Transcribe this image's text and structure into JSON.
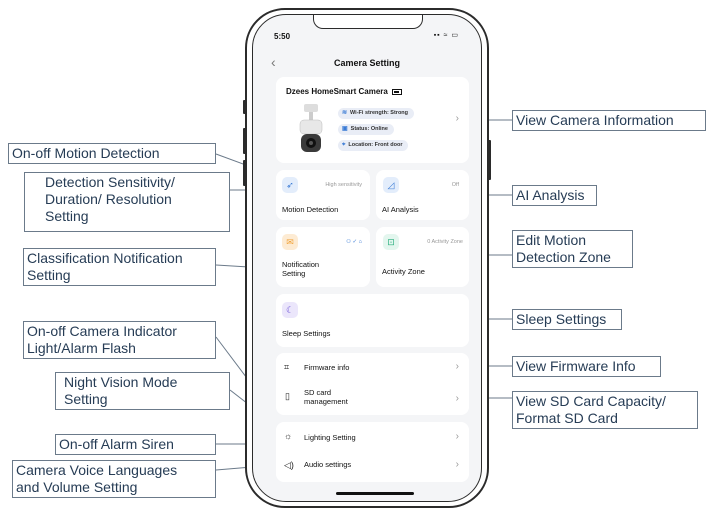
{
  "status_bar": {
    "time": "5:50",
    "icons": "▪▪ ≈ ▭"
  },
  "header": {
    "back": "‹",
    "title": "Camera Setting"
  },
  "camera_card": {
    "name": "Dzees HomeSmart Camera",
    "wifi": "Wi-Fi strength: Strong",
    "status": "Status: Online",
    "location": "Location: Front door"
  },
  "tiles": {
    "motion": {
      "label": "Motion Detection",
      "value": "High sensitivity"
    },
    "ai": {
      "label": "AI Analysis",
      "value": "Off"
    },
    "notification": {
      "label": "Notification Setting"
    },
    "activity": {
      "label": "Activity Zone",
      "value": "0 Activity Zone"
    },
    "sleep": {
      "label": "Sleep Settings"
    }
  },
  "list_rows": {
    "firmware": "Firmware info",
    "sd_card": "SD card management",
    "lighting": "Lighting Setting",
    "audio": "Audio settings"
  },
  "callouts": {
    "motion_onoff": "On-off Motion Detection",
    "detection_setting": "Detection Sensitivity/\nDuration/ Resolution\nSetting",
    "classification": "Classification Notification\nSetting",
    "indicator": "On-off Camera Indicator\nLight/Alarm Flash",
    "night_vision": "Night Vision Mode\nSetting",
    "siren": "On-off Alarm Siren",
    "voice": "Camera Voice Languages\nand Volume Setting",
    "view_camera_info": "View Camera Information",
    "ai_analysis": "AI Analysis",
    "edit_motion_zone": "Edit Motion\nDetection Zone",
    "sleep_settings": "Sleep Settings",
    "view_firmware": "View Firmware Info",
    "sd_capacity": "View SD Card Capacity/\nFormat SD Card"
  },
  "colors": {
    "accent": "#3a7bd5",
    "callout_border": "#6b7a8a",
    "callout_text": "#263c55",
    "notification_icon": "#f0a33a"
  }
}
